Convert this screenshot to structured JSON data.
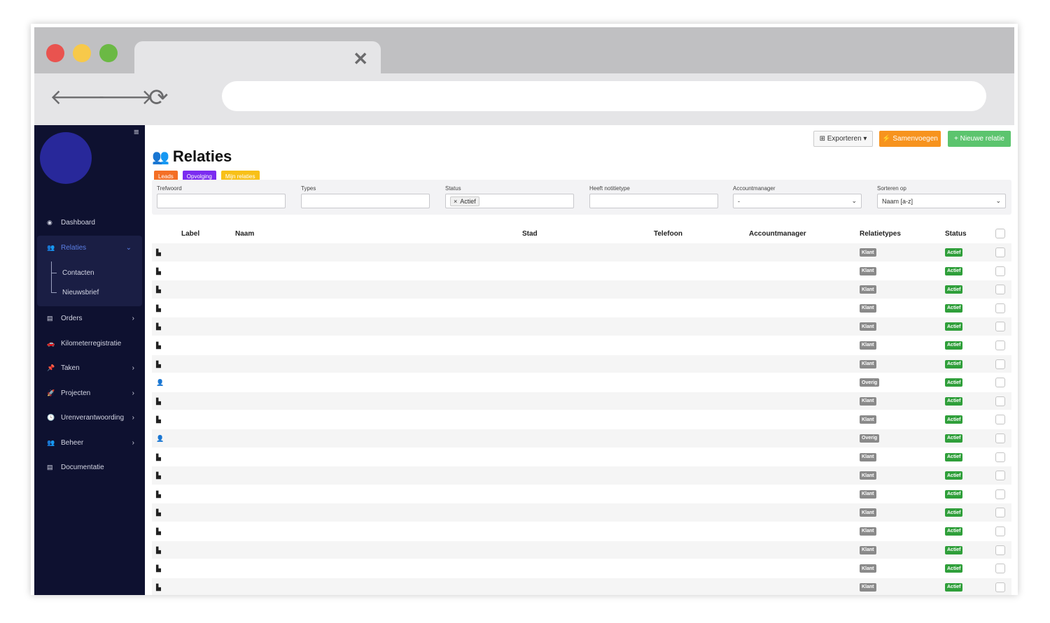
{
  "browser": {
    "tab_close": "✕",
    "back": "🡐",
    "forward": "🡒",
    "reload": "⟳"
  },
  "sidebar": {
    "menu_toggle": "≡",
    "items": [
      {
        "label": "Dashboard",
        "icon": "dashboard-icon",
        "glyph": "◉"
      },
      {
        "label": "Relaties",
        "icon": "users-icon",
        "glyph": "👥",
        "active": true,
        "chevron": "⌄"
      },
      {
        "label": "Orders",
        "icon": "clipboard-icon",
        "glyph": "▤",
        "chevron": "›"
      },
      {
        "label": "Kilometerregistratie",
        "icon": "car-icon",
        "glyph": "🚗"
      },
      {
        "label": "Taken",
        "icon": "pin-icon",
        "glyph": "📌",
        "chevron": "›"
      },
      {
        "label": "Projecten",
        "icon": "rocket-icon",
        "glyph": "🚀",
        "chevron": "›"
      },
      {
        "label": "Urenverantwoording",
        "icon": "clock-icon",
        "glyph": "🕓",
        "chevron": "›"
      },
      {
        "label": "Beheer",
        "icon": "users-icon",
        "glyph": "👥",
        "chevron": "›"
      },
      {
        "label": "Documentatie",
        "icon": "book-icon",
        "glyph": "▤"
      }
    ],
    "subitems": [
      "Contacten",
      "Nieuwsbrief"
    ]
  },
  "toolbar": {
    "export_label": "⊞ Exporteren ▾",
    "merge_label": "⚡ Samenvoegen",
    "new_label": "+ Nieuwe relatie"
  },
  "page": {
    "title": "Relaties",
    "title_icon": "👥"
  },
  "chips": {
    "leads": "Leads",
    "opvolging": "Opvolging",
    "mijn": "Mijn relaties"
  },
  "filters": {
    "trefwoord_label": "Trefwoord",
    "trefwoord_value": "",
    "types_label": "Types",
    "types_value": "",
    "status_label": "Status",
    "status_tag": "Actief",
    "status_tag_remove": "×",
    "notitie_label": "Heeft notitietype",
    "notitie_value": "",
    "accountmanager_label": "Accountmanager",
    "accountmanager_value": "-",
    "sort_label": "Sorteren op",
    "sort_value": "Naam [a-z]",
    "select_arrow": "⌄"
  },
  "table": {
    "headers": {
      "label": "Label",
      "naam": "Naam",
      "stad": "Stad",
      "telefoon": "Telefoon",
      "accountmanager": "Accountmanager",
      "relatietypes": "Relatietypes",
      "status": "Status"
    },
    "rows": [
      {
        "kind": "building",
        "type": "Klant",
        "status": "Actief"
      },
      {
        "kind": "building",
        "type": "Klant",
        "status": "Actief"
      },
      {
        "kind": "building",
        "type": "Klant",
        "status": "Actief"
      },
      {
        "kind": "building",
        "type": "Klant",
        "status": "Actief"
      },
      {
        "kind": "building",
        "type": "Klant",
        "status": "Actief"
      },
      {
        "kind": "building",
        "type": "Klant",
        "status": "Actief"
      },
      {
        "kind": "building",
        "type": "Klant",
        "status": "Actief"
      },
      {
        "kind": "person",
        "type": "Overig",
        "status": "Actief"
      },
      {
        "kind": "building",
        "type": "Klant",
        "status": "Actief"
      },
      {
        "kind": "building",
        "type": "Klant",
        "status": "Actief"
      },
      {
        "kind": "person",
        "type": "Overig",
        "status": "Actief"
      },
      {
        "kind": "building",
        "type": "Klant",
        "status": "Actief"
      },
      {
        "kind": "building",
        "type": "Klant",
        "status": "Actief"
      },
      {
        "kind": "building",
        "type": "Klant",
        "status": "Actief"
      },
      {
        "kind": "building",
        "type": "Klant",
        "status": "Actief"
      },
      {
        "kind": "building",
        "type": "Klant",
        "status": "Actief"
      },
      {
        "kind": "building",
        "type": "Klant",
        "status": "Actief"
      },
      {
        "kind": "building",
        "type": "Klant",
        "status": "Actief"
      },
      {
        "kind": "building",
        "type": "Klant",
        "status": "Actief"
      }
    ],
    "icons": {
      "building": "▙",
      "person": "👤"
    }
  }
}
